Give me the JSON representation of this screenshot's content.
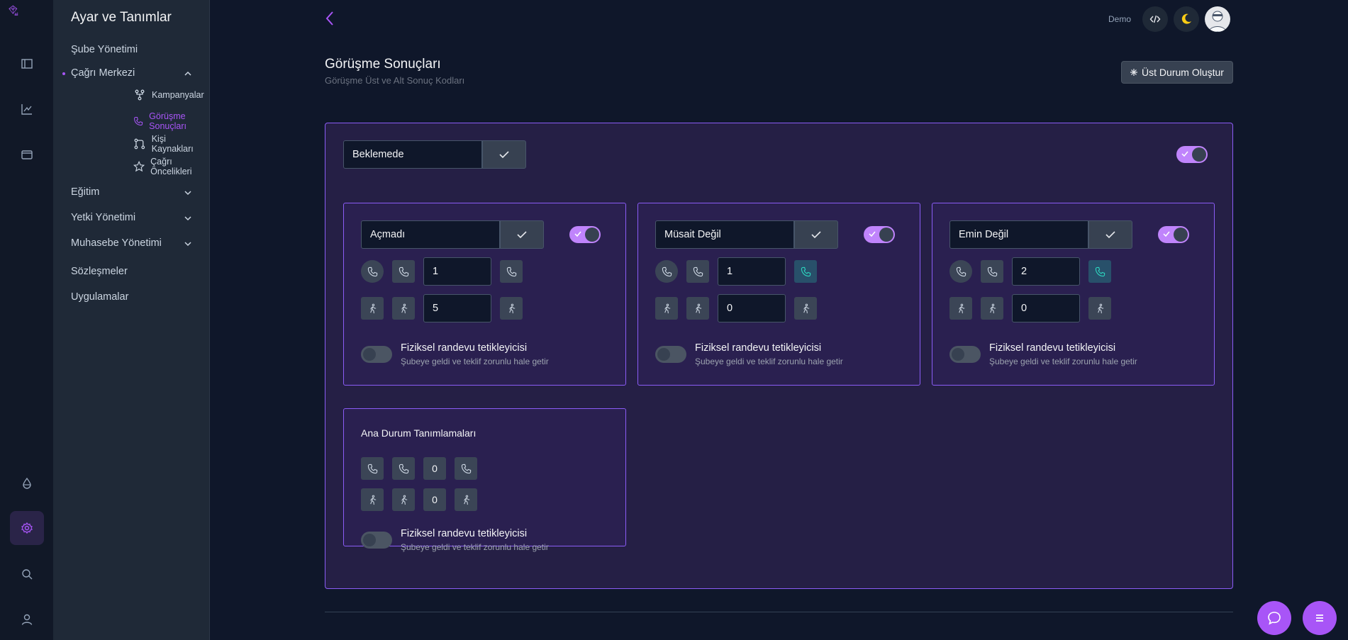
{
  "sidebar": {
    "title": "Ayar ve Tanımlar",
    "items": [
      {
        "label": "Şube Yönetimi"
      },
      {
        "label": "Çağrı Merkezi"
      },
      {
        "label": "Eğitim"
      },
      {
        "label": "Yetki Yönetimi"
      },
      {
        "label": "Muhasebe Yönetimi"
      },
      {
        "label": "Sözleşmeler"
      },
      {
        "label": "Uygulamalar"
      }
    ],
    "subitems": [
      {
        "label": "Kampanyalar",
        "icon": "fork-icon"
      },
      {
        "label": "Görüşme Sonuçları",
        "icon": "phone-icon"
      },
      {
        "label": "Kişi Kaynakları",
        "icon": "merge-icon"
      },
      {
        "label": "Çağrı Öncelikleri",
        "icon": "star-icon"
      }
    ]
  },
  "header": {
    "demo": "Demo"
  },
  "page": {
    "title": "Görüşme Sonuçları",
    "subtitle": "Görüşme Üst ve Alt Sonuç Kodları",
    "create_button": "Üst Durum Oluştur"
  },
  "parent": {
    "name": "Beklemede",
    "enabled": true
  },
  "cards": [
    {
      "name": "Açmadı",
      "enabled": true,
      "call_value": "1",
      "visit_value": "5",
      "trigger_title": "Fiziksel randevu tetikleyicisi",
      "trigger_sub": "Şubeye geldi ve teklif zorunlu hale getir"
    },
    {
      "name": "Müsait Değil",
      "enabled": true,
      "call_value": "1",
      "visit_value": "0",
      "trigger_title": "Fiziksel randevu tetikleyicisi",
      "trigger_sub": "Şubeye geldi ve teklif zorunlu hale getir"
    },
    {
      "name": "Emin Değil",
      "enabled": true,
      "call_value": "2",
      "visit_value": "0",
      "trigger_title": "Fiziksel randevu tetikleyicisi",
      "trigger_sub": "Şubeye geldi ve teklif zorunlu hale getir"
    }
  ],
  "main_card": {
    "title": "Ana Durum Tanımlamaları",
    "call_value": "0",
    "visit_value": "0",
    "trigger_title": "Fiziksel randevu tetikleyicisi",
    "trigger_sub": "Şubeye geldi ve teklif zorunlu hale getir"
  },
  "colors": {
    "accent": "#a855f7",
    "background": "#0f172a",
    "card": "#2a2050"
  }
}
